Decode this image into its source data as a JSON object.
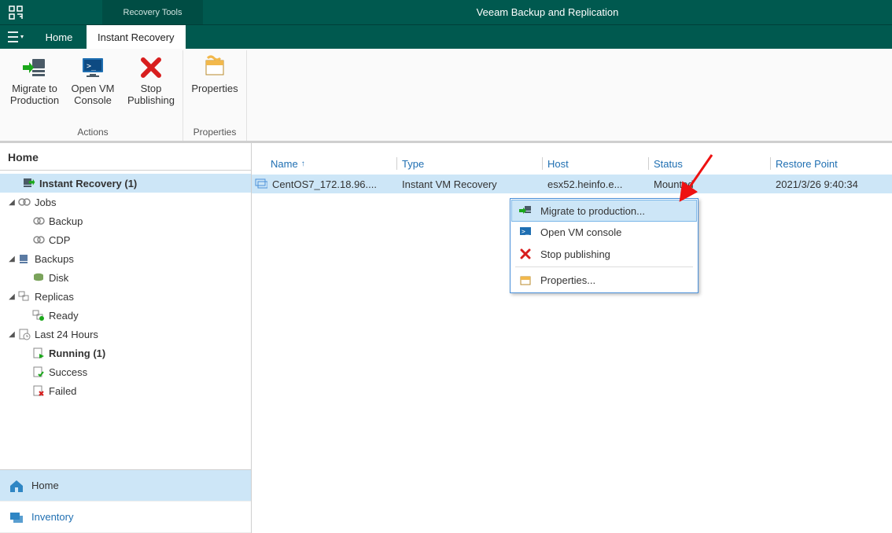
{
  "app": {
    "title": "Veeam Backup and Replication",
    "context_tab": "Recovery Tools",
    "tabs": {
      "home": "Home",
      "instant_recovery": "Instant Recovery"
    }
  },
  "ribbon": {
    "actions_group": "Actions",
    "properties_group": "Properties",
    "migrate_line1": "Migrate to",
    "migrate_line2": "Production",
    "openvm_line1": "Open VM",
    "openvm_line2": "Console",
    "stop_line1": "Stop",
    "stop_line2": "Publishing",
    "properties_label": "Properties"
  },
  "sidebar": {
    "pane_title": "Home",
    "tree": {
      "instant_recovery": "Instant Recovery (1)",
      "jobs": "Jobs",
      "backup": "Backup",
      "cdp": "CDP",
      "backups": "Backups",
      "disk": "Disk",
      "replicas": "Replicas",
      "ready": "Ready",
      "last24": "Last 24 Hours",
      "running": "Running (1)",
      "success": "Success",
      "failed": "Failed"
    },
    "nav": {
      "home": "Home",
      "inventory": "Inventory"
    }
  },
  "grid": {
    "headers": {
      "name": "Name",
      "type": "Type",
      "host": "Host",
      "status": "Status",
      "restore": "Restore Point"
    },
    "rows": [
      {
        "name": "CentOS7_172.18.96....",
        "type": "Instant VM Recovery",
        "host": "esx52.heinfo.e...",
        "status": "Mounted",
        "restore": "2021/3/26 9:40:34"
      }
    ]
  },
  "contextmenu": {
    "migrate": "Migrate to production...",
    "openvm": "Open VM console",
    "stop": "Stop publishing",
    "properties": "Properties..."
  }
}
